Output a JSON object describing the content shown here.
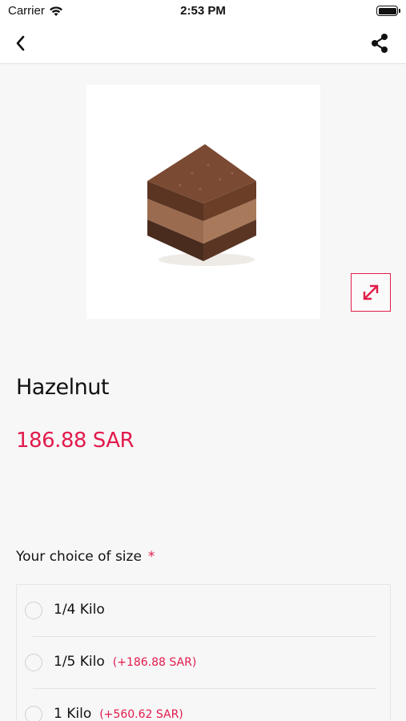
{
  "status_bar": {
    "carrier": "Carrier",
    "time": "2:53 PM",
    "wifi_icon": "wifi-icon",
    "battery_icon": "battery-icon"
  },
  "nav": {
    "back_icon": "chevron-left-icon",
    "share_icon": "share-icon"
  },
  "product": {
    "name": "Hazelnut",
    "price": "186.88 SAR",
    "image_alt": "hazelnut-cake-square-image",
    "expand_icon": "expand-diagonal-icon"
  },
  "options": {
    "heading": "Your choice of size",
    "required_mark": "*",
    "items": [
      {
        "label": "1/4 Kilo",
        "extra": ""
      },
      {
        "label": "1/5 Kilo",
        "extra": "(+186.88 SAR)"
      },
      {
        "label": "1 Kilo",
        "extra": "(+560.62 SAR)"
      }
    ]
  },
  "colors": {
    "accent": "#e21b4d",
    "background": "#f7f7f7"
  }
}
